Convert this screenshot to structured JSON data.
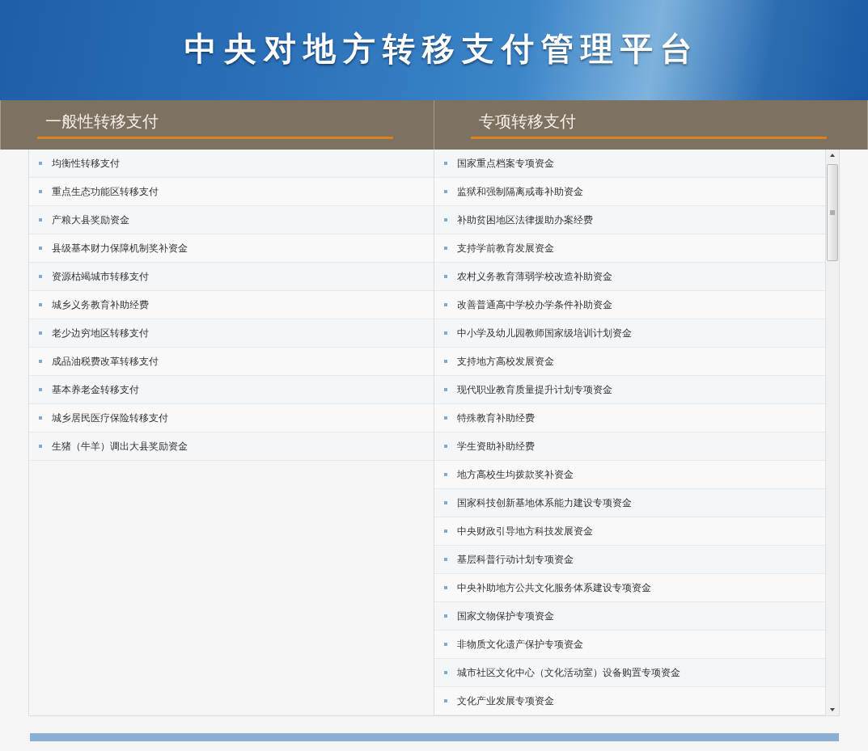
{
  "banner": {
    "title": "中央对地方转移支付管理平台"
  },
  "panels": [
    {
      "heading": "一般性转移支付",
      "items": [
        "均衡性转移支付",
        "重点生态功能区转移支付",
        "产粮大县奖励资金",
        "县级基本财力保障机制奖补资金",
        "资源枯竭城市转移支付",
        "城乡义务教育补助经费",
        "老少边穷地区转移支付",
        "成品油税费改革转移支付",
        "基本养老金转移支付",
        "城乡居民医疗保险转移支付",
        "生猪（牛羊）调出大县奖励资金"
      ]
    },
    {
      "heading": "专项转移支付",
      "items": [
        "国家重点档案专项资金",
        "监狱和强制隔离戒毒补助资金",
        "补助贫困地区法律援助办案经费",
        "支持学前教育发展资金",
        "农村义务教育薄弱学校改造补助资金",
        "改善普通高中学校办学条件补助资金",
        "中小学及幼儿园教师国家级培训计划资金",
        "支持地方高校发展资金",
        "现代职业教育质量提升计划专项资金",
        "特殊教育补助经费",
        "学生资助补助经费",
        "地方高校生均拨款奖补资金",
        "国家科技创新基地体系能力建设专项资金",
        "中央财政引导地方科技发展资金",
        "基层科普行动计划专项资金",
        "中央补助地方公共文化服务体系建设专项资金",
        "国家文物保护专项资金",
        "非物质文化遗产保护专项资金",
        "城市社区文化中心（文化活动室）设备购置专项资金",
        "文化产业发展专项资金"
      ]
    }
  ]
}
